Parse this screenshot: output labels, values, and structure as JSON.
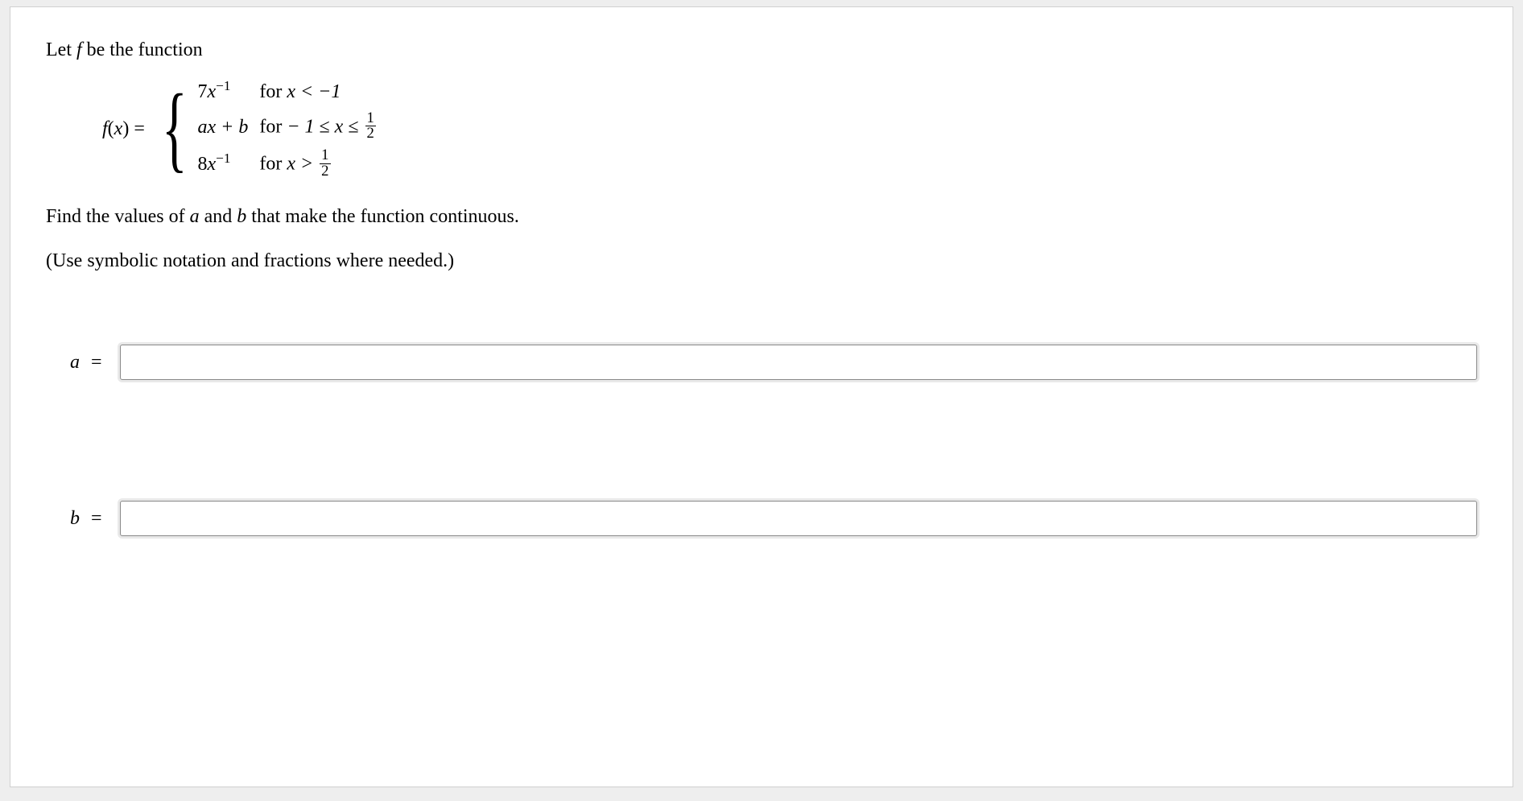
{
  "intro": {
    "prefix": "Let ",
    "fvar": "f",
    "suffix": " be the function"
  },
  "equation": {
    "lhs_f": "f",
    "lhs_of": "(",
    "lhs_x": "x",
    "lhs_close": ") = ",
    "cases": [
      {
        "coef": "7",
        "var": "x",
        "exp": "−1",
        "tail": "",
        "cond_prefix": "for ",
        "cond": "x < −1"
      },
      {
        "coef": "a",
        "var": "x",
        "exp": "",
        "tail": " + b",
        "cond_prefix": "for ",
        "cond_range": {
          "lead": "− 1 ≤ x ≤ ",
          "frac_num": "1",
          "frac_den": "2"
        }
      },
      {
        "coef": "8",
        "var": "x",
        "exp": "−1",
        "tail": "",
        "cond_prefix": "for ",
        "cond_gt": {
          "lead": "x > ",
          "frac_num": "1",
          "frac_den": "2"
        }
      }
    ]
  },
  "question": {
    "t1": "Find the values of ",
    "a": "a",
    "t2": " and ",
    "b": "b",
    "t3": " that make the function continuous."
  },
  "hint": "(Use symbolic notation and fractions where needed.)",
  "answers": {
    "a": {
      "var": "a",
      "eq": "=",
      "value": "",
      "placeholder": ""
    },
    "b": {
      "var": "b",
      "eq": "=",
      "value": "",
      "placeholder": ""
    }
  }
}
